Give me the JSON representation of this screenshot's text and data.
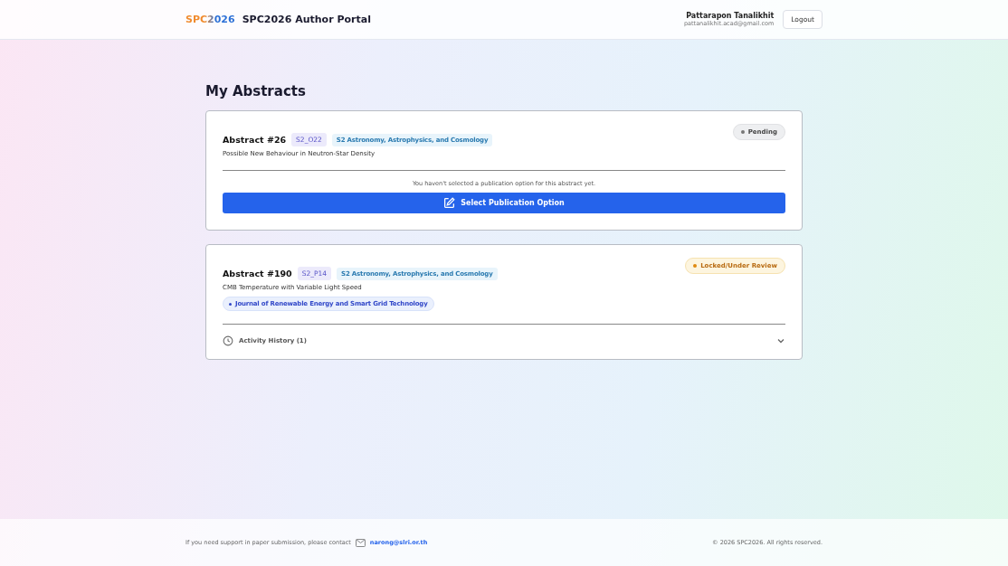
{
  "header": {
    "logo": "SPC2026",
    "title": "SPC2026 Author Portal",
    "user_name": "Pattarapon Tanalikhit",
    "user_email": "pattanalikhit.acad@gmail.com",
    "logout": "Logout"
  },
  "page_title": "My Abstracts",
  "abstracts": [
    {
      "title": "Abstract #26",
      "code": "S2_O22",
      "track": "S2 Astronomy, Astrophysics, and Cosmology",
      "name": "Possible New Behaviour in Neutron-Star Density",
      "status": {
        "kind": "pending",
        "label": "Pending"
      },
      "footer": {
        "kind": "select",
        "message": "You haven't selected a publication option for this abstract yet.",
        "button": "Select Publication Option"
      }
    },
    {
      "title": "Abstract #190",
      "code": "S2_P14",
      "track": "S2 Astronomy, Astrophysics, and Cosmology",
      "name": "CMB Temperature with Variable Light Speed",
      "journal": "Journal of Renewable Energy and Smart Grid Technology",
      "status": {
        "kind": "locked",
        "label": "Locked/Under Review"
      },
      "footer": {
        "kind": "history",
        "label": "Activity History (1)",
        "expanded": false
      }
    }
  ],
  "footer": {
    "support_text": "If you need support in paper submission, please contact",
    "email": "narong@slri.or.th",
    "copyright": "© 2026 SPC2026. All rights reserved."
  }
}
